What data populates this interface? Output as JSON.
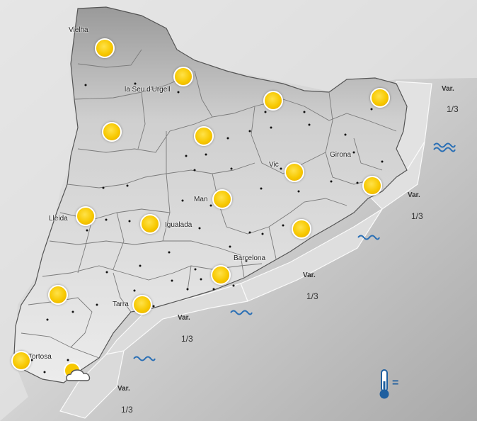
{
  "cities": [
    {
      "id": "vielha",
      "label": "Vielha"
    },
    {
      "id": "la-seu",
      "label": "la Seu d'Urgell"
    },
    {
      "id": "girona",
      "label": "Girona"
    },
    {
      "id": "vic",
      "label": "Vic"
    },
    {
      "id": "manresa",
      "label": "Man"
    },
    {
      "id": "lleida",
      "label": "Lleida"
    },
    {
      "id": "igualada",
      "label": "Igualada"
    },
    {
      "id": "barcelona",
      "label": "Barcelona"
    },
    {
      "id": "tarragona",
      "label": "Tarra"
    },
    {
      "id": "tortosa",
      "label": "Tortosa"
    }
  ],
  "weather_icons": [
    {
      "id": "vielha",
      "type": "sun-icon"
    },
    {
      "id": "la-seu",
      "type": "sun-icon"
    },
    {
      "id": "ripolles",
      "type": "sun-icon"
    },
    {
      "id": "emporda",
      "type": "sun-icon"
    },
    {
      "id": "pallars",
      "type": "sun-icon"
    },
    {
      "id": "bergueda",
      "type": "sun-icon"
    },
    {
      "id": "vic",
      "type": "sun-icon"
    },
    {
      "id": "costa-brava",
      "type": "sun-icon"
    },
    {
      "id": "manresa",
      "type": "sun-icon"
    },
    {
      "id": "lleida",
      "type": "sun-icon"
    },
    {
      "id": "igualada",
      "type": "sun-icon"
    },
    {
      "id": "maresme",
      "type": "sun-icon"
    },
    {
      "id": "penedes",
      "type": "sun-icon"
    },
    {
      "id": "priorat",
      "type": "sun-icon"
    },
    {
      "id": "tarragona",
      "type": "sun-icon"
    },
    {
      "id": "tortosa",
      "type": "sun-icon"
    },
    {
      "id": "delta",
      "type": "partly-cloudy-icon"
    }
  ],
  "sea_zones": [
    {
      "id": "north",
      "wind": "Var.",
      "wave": "1/3"
    },
    {
      "id": "costa-brava",
      "wind": "Var.",
      "wave": "1/3"
    },
    {
      "id": "barcelona",
      "wind": "Var.",
      "wave": "1/3"
    },
    {
      "id": "tarragona",
      "wind": "Var.",
      "wave": "1/3"
    },
    {
      "id": "ebre",
      "wind": "Var.",
      "wave": "1/3"
    }
  ],
  "sea_state_icons": [
    "waves-icon",
    "waves-icon",
    "waves-icon",
    "waves-icon"
  ],
  "temperature_trend": {
    "icon": "thermometer-icon",
    "symbol": "="
  },
  "colors": {
    "sun": "#f7c800",
    "waves": "#2a6fb5",
    "thermometer": "#1f5f9f",
    "sea": "#bdbdbd",
    "land": "#e6e6e6"
  }
}
